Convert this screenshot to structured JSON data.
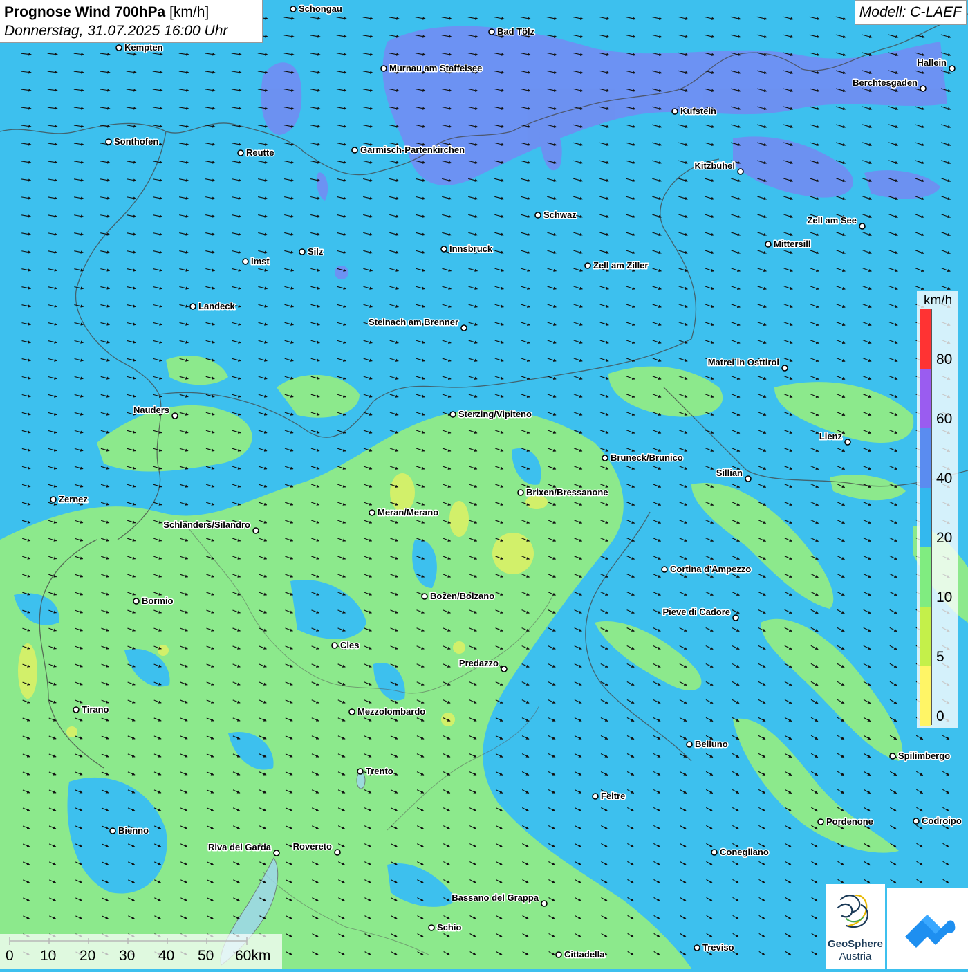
{
  "title": {
    "main": "Prognose Wind 700hPa",
    "unit": "[km/h]",
    "datetime": "Donnerstag, 31.07.2025 16:00 Uhr"
  },
  "model": "Modell: C-LAEF",
  "legend": {
    "unit": "km/h",
    "ticks": [
      "80",
      "60",
      "40",
      "20",
      "10",
      "5",
      "0"
    ],
    "colors": [
      "#ff3333",
      "#9a5cf0",
      "#5a8cf0",
      "#33b8ee",
      "#80ec80",
      "#c4f04a",
      "#fff566"
    ]
  },
  "scalebar": {
    "ticks": [
      "0",
      "10",
      "20",
      "30",
      "40",
      "50",
      "60km"
    ]
  },
  "logos": {
    "geosphere_line1": "GeoSphere",
    "geosphere_line2": "Austria"
  },
  "cities": [
    {
      "name": "Schongau",
      "align": "right"
    },
    {
      "name": "Bad Tölz",
      "align": "right"
    },
    {
      "name": "Kempten",
      "align": "right"
    },
    {
      "name": "Murnau am Staffelsee",
      "align": "right"
    },
    {
      "name": "Hallein",
      "align": "left"
    },
    {
      "name": "Berchtesgaden",
      "align": "left"
    },
    {
      "name": "Kufstein",
      "align": "right"
    },
    {
      "name": "Sonthofen",
      "align": "right"
    },
    {
      "name": "Reutte",
      "align": "right"
    },
    {
      "name": "Garmisch-Partenkirchen",
      "align": "right"
    },
    {
      "name": "Kitzbühel",
      "align": "left"
    },
    {
      "name": "Schwaz",
      "align": "right"
    },
    {
      "name": "Zell am See",
      "align": "left"
    },
    {
      "name": "Mittersill",
      "align": "right"
    },
    {
      "name": "Silz",
      "align": "right"
    },
    {
      "name": "Innsbruck",
      "align": "right"
    },
    {
      "name": "Imst",
      "align": "right"
    },
    {
      "name": "Zell am Ziller",
      "align": "right"
    },
    {
      "name": "Landeck",
      "align": "right"
    },
    {
      "name": "Steinach am Brenner",
      "align": "left"
    },
    {
      "name": "Matrei in Osttirol",
      "align": "left"
    },
    {
      "name": "Nauders",
      "align": "left"
    },
    {
      "name": "Sterzing/Vipiteno",
      "align": "right"
    },
    {
      "name": "Lienz",
      "align": "left"
    },
    {
      "name": "Bruneck/Brunico",
      "align": "right"
    },
    {
      "name": "Sillian",
      "align": "left"
    },
    {
      "name": "Brixen/Bressanone",
      "align": "right"
    },
    {
      "name": "Zernez",
      "align": "right"
    },
    {
      "name": "Meran/Merano",
      "align": "right"
    },
    {
      "name": "Schlanders/Silandro",
      "align": "left"
    },
    {
      "name": "Cortina d'Ampezzo",
      "align": "right"
    },
    {
      "name": "Bozen/Bolzano",
      "align": "right"
    },
    {
      "name": "Bormio",
      "align": "right"
    },
    {
      "name": "Pieve di Cadore",
      "align": "left"
    },
    {
      "name": "Cles",
      "align": "right"
    },
    {
      "name": "Predazzo",
      "align": "left"
    },
    {
      "name": "Tirano",
      "align": "right"
    },
    {
      "name": "Mezzolombardo",
      "align": "right"
    },
    {
      "name": "Belluno",
      "align": "right"
    },
    {
      "name": "Spilimbergo",
      "align": "right"
    },
    {
      "name": "Trento",
      "align": "right"
    },
    {
      "name": "Feltre",
      "align": "right"
    },
    {
      "name": "Pordenone",
      "align": "right"
    },
    {
      "name": "Codroipo",
      "align": "right"
    },
    {
      "name": "Bienno",
      "align": "right"
    },
    {
      "name": "Riva del Garda",
      "align": "left"
    },
    {
      "name": "Rovereto",
      "align": "left"
    },
    {
      "name": "Conegliano",
      "align": "right"
    },
    {
      "name": "Bassano del Grappa",
      "align": "left"
    },
    {
      "name": "Schio",
      "align": "right"
    },
    {
      "name": "Treviso",
      "align": "right"
    },
    {
      "name": "Cittadella",
      "align": "right"
    }
  ]
}
